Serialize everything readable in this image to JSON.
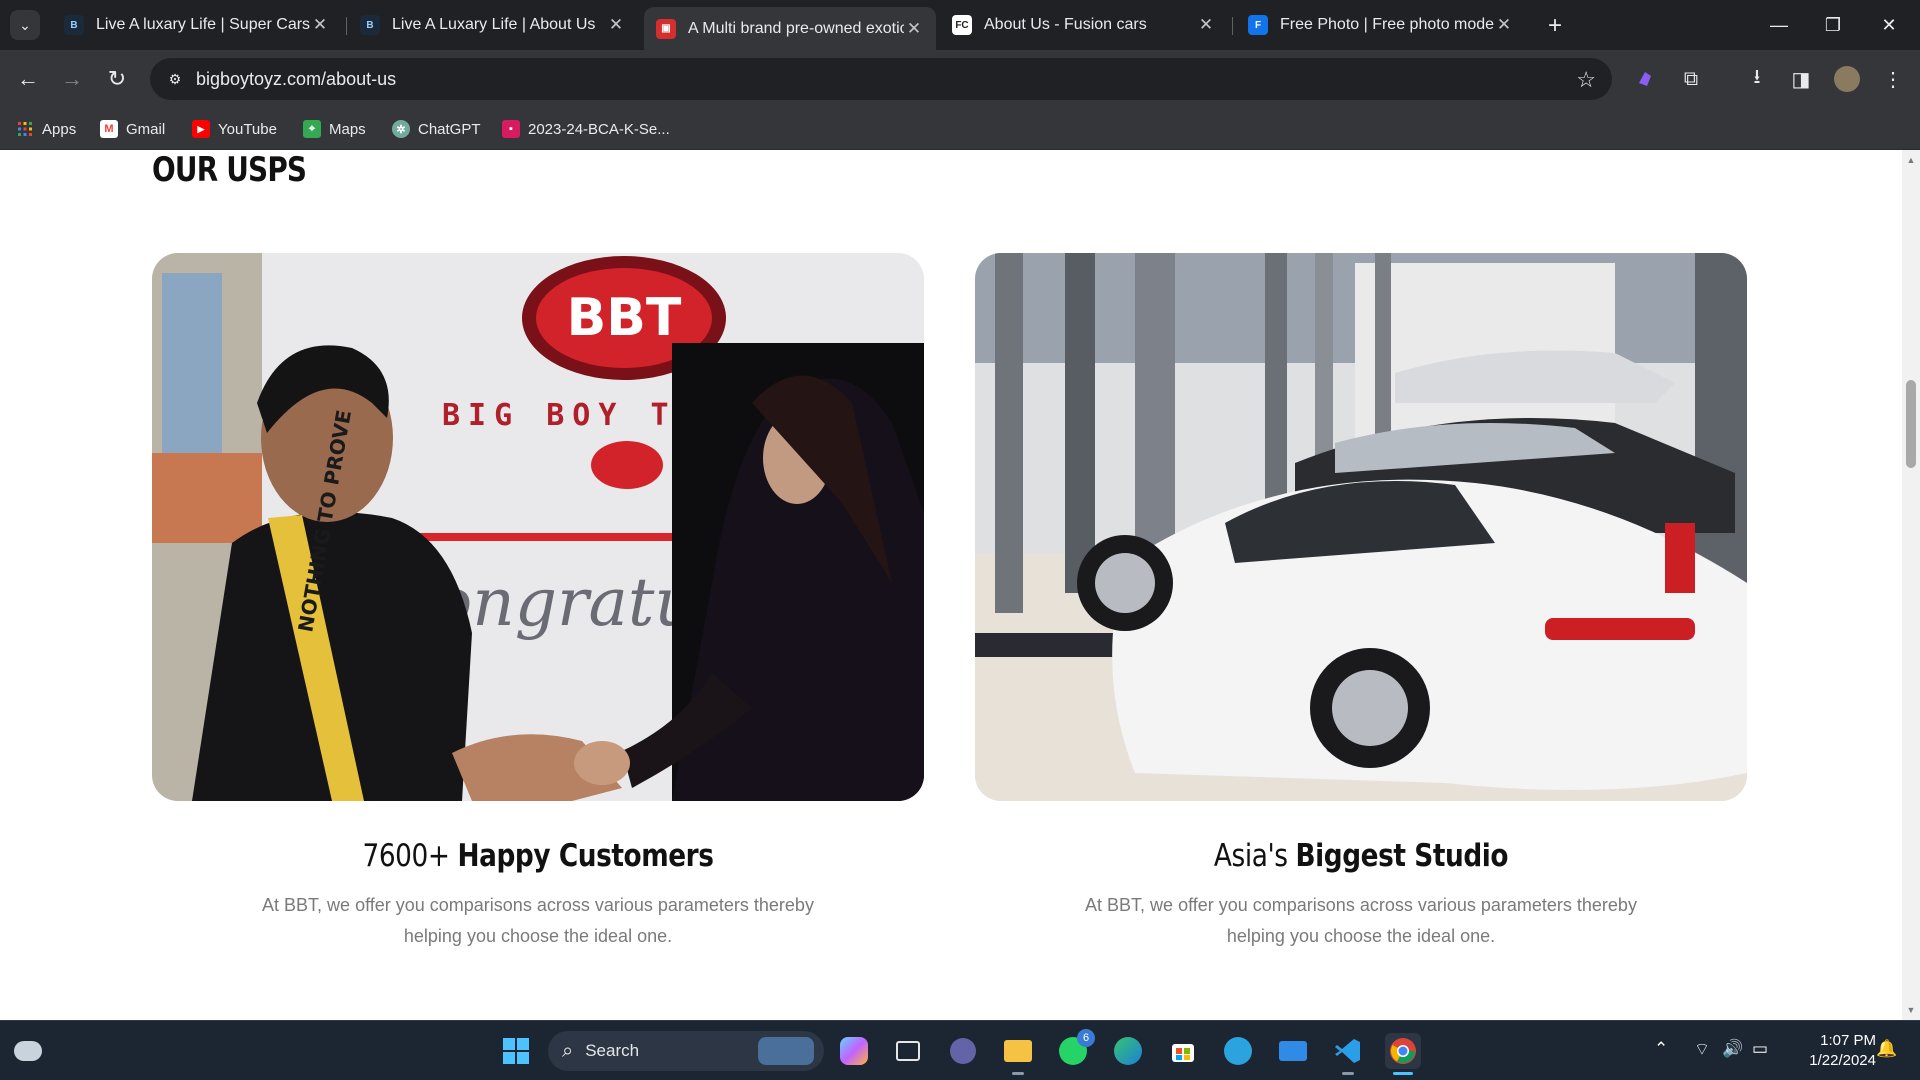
{
  "browser": {
    "tab_search_icon": "chevron-down-icon",
    "tabs": [
      {
        "title": "Live A luxary Life | Super Cars",
        "favicon": "bbt-icon",
        "active": false
      },
      {
        "title": "Live A Luxary Life | About Us",
        "favicon": "bbt-icon",
        "active": false
      },
      {
        "title": "A Multi brand pre-owned exotic",
        "favicon": "car-icon",
        "active": true
      },
      {
        "title": "About Us - Fusion cars",
        "favicon": "fusion-icon",
        "active": false
      },
      {
        "title": "Free Photo | Free photo modern",
        "favicon": "freepik-icon",
        "active": false
      }
    ],
    "close_glyph": "✕",
    "new_tab_glyph": "+",
    "url": "bigboytoyz.com/about-us",
    "bookmarks": [
      {
        "label": "Apps",
        "icon": "apps-grid-icon"
      },
      {
        "label": "Gmail",
        "icon": "gmail-icon"
      },
      {
        "label": "YouTube",
        "icon": "youtube-icon"
      },
      {
        "label": "Maps",
        "icon": "maps-icon"
      },
      {
        "label": "ChatGPT",
        "icon": "chatgpt-icon"
      },
      {
        "label": "2023-24-BCA-K-Se...",
        "icon": "classroom-icon"
      }
    ]
  },
  "page": {
    "section_title": "OUR USPS",
    "cards": [
      {
        "title_prefix": "7600+ ",
        "title_bold": "Happy Customers",
        "description": "At BBT, we offer you comparisons across various parameters thereby helping you choose the ideal one.",
        "image": "customer-handshake-photo",
        "image_text": {
          "logo": "BBT",
          "banner": "BIG BOY TOYZ",
          "script": "Congratul",
          "shirt": "NOTHING TO PROVE"
        }
      },
      {
        "title_prefix": "Asia's ",
        "title_bold": "Biggest Studio",
        "description": "At BBT, we offer you comparisons across various parameters thereby helping you choose the ideal one.",
        "image": "showroom-cars-photo"
      }
    ]
  },
  "taskbar": {
    "search_label": "Search",
    "whatsapp_badge": "6",
    "time": "1:07 PM",
    "date": "1/22/2024"
  },
  "colors": {
    "chrome_dark": "#202124",
    "chrome_toolbar": "#35363a",
    "page_bg": "#ffffff",
    "title_text": "#111111",
    "desc_text": "#7a7a7a",
    "taskbar_bg": "#1c2633",
    "accent": "#4cc2ff"
  }
}
